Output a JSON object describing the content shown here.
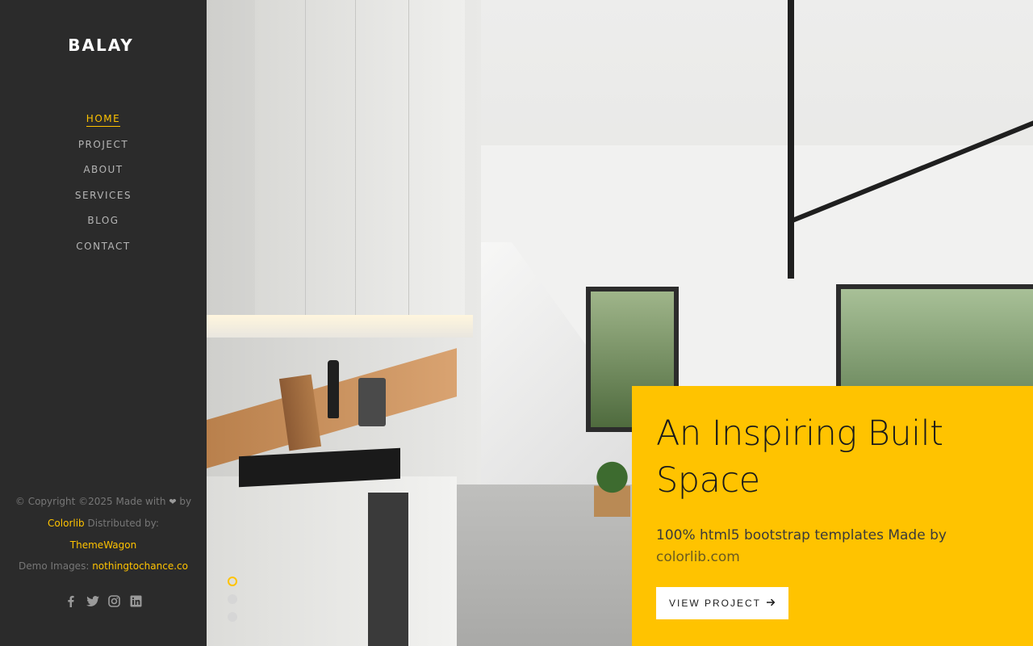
{
  "brand": "BALAY",
  "nav": [
    {
      "label": "HOME",
      "active": true
    },
    {
      "label": "PROJECT"
    },
    {
      "label": "ABOUT"
    },
    {
      "label": "SERVICES"
    },
    {
      "label": "BLOG"
    },
    {
      "label": "CONTACT"
    }
  ],
  "footer": {
    "copyright": "© Copyright ©2025 Made with",
    "by": "by",
    "colorlib": "Colorlib",
    "distributed": "Distributed by:",
    "themewagon": "ThemeWagon",
    "demo_label": "Demo Images:",
    "demo_link": "nothingtochance.co"
  },
  "social": [
    "facebook-icon",
    "twitter-icon",
    "instagram-icon",
    "linkedin-icon"
  ],
  "hero": {
    "title": "An Inspiring Built Space",
    "subtitle_a": "100% html5 bootstrap templates Made by",
    "subtitle_b": "colorlib.com",
    "button": "VIEW PROJECT",
    "slides": 3,
    "active_slide": 1
  },
  "colors": {
    "accent": "#ffc300",
    "sidebar": "#2b2b2b"
  }
}
